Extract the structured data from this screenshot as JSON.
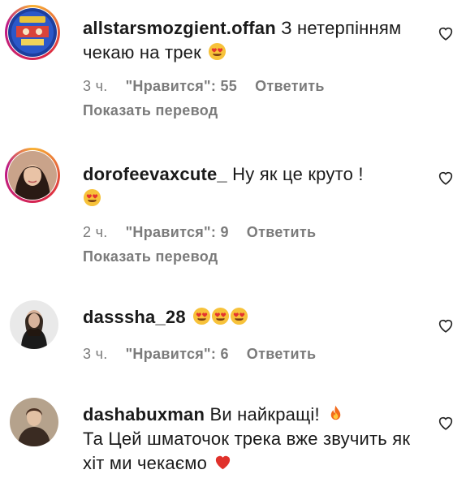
{
  "comments": [
    {
      "username": "allstarsmozgient.offan",
      "text": " З нетерпінням чекаю на трек",
      "emoji": "heart-eyes-icon",
      "time": "3 ч.",
      "likes": "\"Нравится\": 55",
      "reply": "Ответить",
      "translate": "Показать перевод"
    },
    {
      "username": "dorofeevaxcute_",
      "text": " Ну як це круто !",
      "emoji": "heart-eyes-icon",
      "time": "2 ч.",
      "likes": "\"Нравится\": 9",
      "reply": "Ответить",
      "translate": "Показать перевод"
    },
    {
      "username": "dasssha_28",
      "text": "",
      "emoji": "heart-eyes-icon x3",
      "time": "3 ч.",
      "likes": "\"Нравится\": 6",
      "reply": "Ответить"
    },
    {
      "username": "dashabuxman",
      "text": " Ви найкращі!",
      "text2": "Та Цей шматочок трека вже звучить як хіт ми чекаємо",
      "emoji": "fire-icon",
      "emoji2": "red-heart-icon"
    }
  ],
  "colors": {
    "meta_gray": "#7b7b7b",
    "text": "#1a1a1a"
  }
}
